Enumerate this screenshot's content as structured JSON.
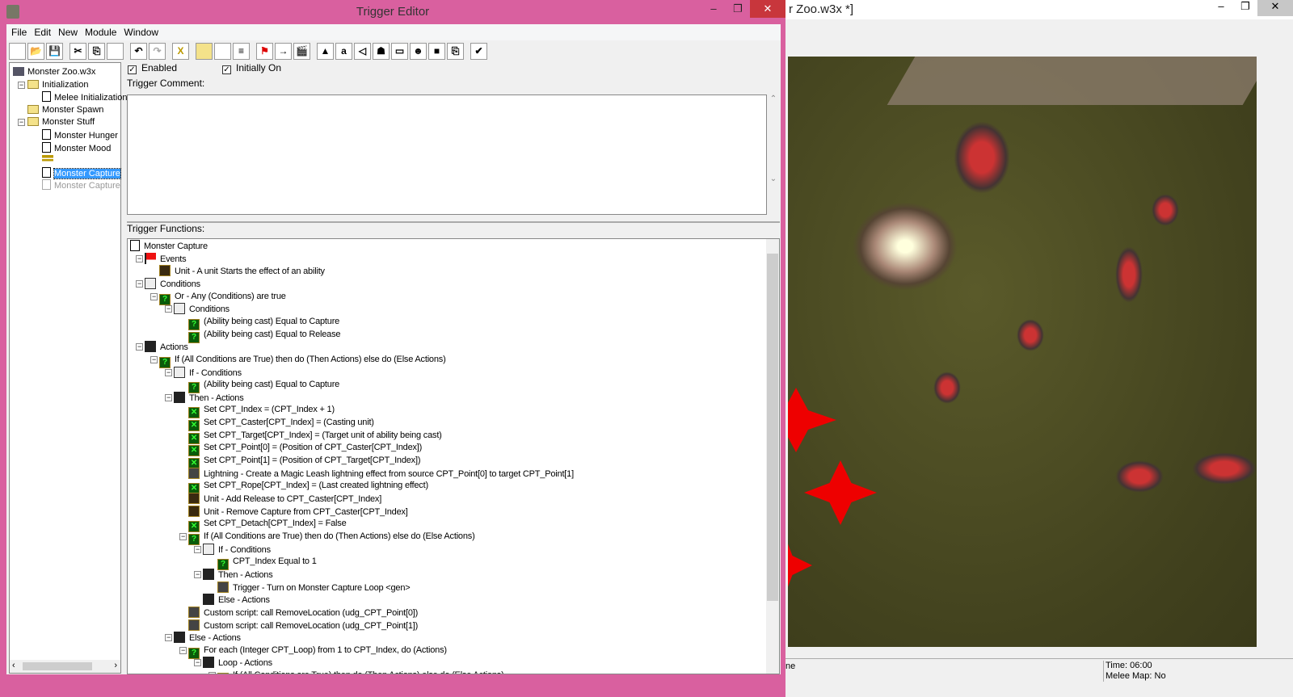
{
  "background_window": {
    "title": "r Zoo.w3x *]",
    "status_left": "ne",
    "time": "Time: 06:00",
    "melee": "Melee Map: No"
  },
  "window": {
    "title": "Trigger Editor",
    "controls": [
      "–",
      "❐",
      "✕"
    ]
  },
  "menu": [
    "File",
    "Edit",
    "New",
    "Module",
    "Window"
  ],
  "toolbar": [
    "new",
    "open",
    "save",
    "cut",
    "copy",
    "paste",
    "undo",
    "redo",
    "delete",
    "new-category",
    "new-trigger",
    "new-comment",
    "new-event",
    "new-condition",
    "new-action",
    "terrain",
    "unit",
    "sound",
    "object",
    "campaign",
    "ai",
    "import",
    "object-manager",
    "test-map"
  ],
  "tree": {
    "items": [
      {
        "label": "Monster Zoo.w3x",
        "icon": "map",
        "level": 0
      },
      {
        "label": "Initialization",
        "icon": "folder",
        "level": 1,
        "toggle": "−"
      },
      {
        "label": "Melee Initialization",
        "icon": "doc",
        "level": 2
      },
      {
        "label": "Monster Spawn",
        "icon": "folder",
        "level": 1
      },
      {
        "label": "Monster Stuff",
        "icon": "folder",
        "level": 1,
        "toggle": "−"
      },
      {
        "label": "Monster Hunger",
        "icon": "doc",
        "level": 2
      },
      {
        "label": "Monster Mood",
        "icon": "doc",
        "level": 2
      },
      {
        "label": "",
        "icon": "comment",
        "level": 2
      },
      {
        "label": "Monster Capture",
        "icon": "doc",
        "level": 2,
        "selected": true
      },
      {
        "label": "Monster Capture",
        "icon": "doc-disabled",
        "level": 2,
        "disabled": true
      }
    ]
  },
  "trigger": {
    "enabled_label": "Enabled",
    "enabled": true,
    "initially_on_label": "Initially On",
    "initially_on": true,
    "comment_label": "Trigger Comment:",
    "comment": "",
    "functions_label": "Trigger Functions:"
  },
  "functions": [
    {
      "t": "Monster Capture",
      "i": "doc",
      "l": 0
    },
    {
      "t": "Events",
      "i": "flag",
      "l": 1,
      "g": 1
    },
    {
      "t": "Unit - A unit Starts the effect of an ability",
      "i": "unit",
      "l": 2
    },
    {
      "t": "Conditions",
      "i": "cond",
      "l": 1,
      "g": 1
    },
    {
      "t": "Or - Any (Conditions) are true",
      "i": "green",
      "l": 2,
      "g": 1
    },
    {
      "t": "Conditions",
      "i": "cond",
      "l": 3,
      "g": 1
    },
    {
      "t": "(Ability being cast) Equal to Capture",
      "i": "green",
      "l": 4
    },
    {
      "t": "(Ability being cast) Equal to Release",
      "i": "green",
      "l": 4
    },
    {
      "t": "Actions",
      "i": "clap",
      "l": 1,
      "g": 1
    },
    {
      "t": "If (All Conditions are True) then do (Then Actions) else do (Else Actions)",
      "i": "green",
      "l": 2,
      "g": 1
    },
    {
      "t": "If - Conditions",
      "i": "cond",
      "l": 3,
      "g": 1
    },
    {
      "t": "(Ability being cast) Equal to Capture",
      "i": "green",
      "l": 4
    },
    {
      "t": "Then - Actions",
      "i": "clap",
      "l": 3,
      "g": 1
    },
    {
      "t": "Set CPT_Index = (CPT_Index + 1)",
      "i": "set",
      "l": 4
    },
    {
      "t": "Set CPT_Caster[CPT_Index] = (Casting unit)",
      "i": "set",
      "l": 4
    },
    {
      "t": "Set CPT_Target[CPT_Index] = (Target unit of ability being cast)",
      "i": "set",
      "l": 4
    },
    {
      "t": "Set CPT_Point[0] = (Position of CPT_Caster[CPT_Index])",
      "i": "set",
      "l": 4
    },
    {
      "t": "Set CPT_Point[1] = (Position of CPT_Target[CPT_Index])",
      "i": "set",
      "l": 4
    },
    {
      "t": "Lightning - Create a Magic Leash lightning effect from source CPT_Point[0] to target CPT_Point[1]",
      "i": "gear",
      "l": 4
    },
    {
      "t": "Set CPT_Rope[CPT_Index] = (Last created lightning effect)",
      "i": "set",
      "l": 4
    },
    {
      "t": "Unit - Add Release  to CPT_Caster[CPT_Index]",
      "i": "unit",
      "l": 4
    },
    {
      "t": "Unit - Remove Capture  from CPT_Caster[CPT_Index]",
      "i": "unit",
      "l": 4
    },
    {
      "t": "Set CPT_Detach[CPT_Index] = False",
      "i": "set",
      "l": 4
    },
    {
      "t": "If (All Conditions are True) then do (Then Actions) else do (Else Actions)",
      "i": "green",
      "l": 4,
      "g": 1
    },
    {
      "t": "If - Conditions",
      "i": "cond",
      "l": 5,
      "g": 1
    },
    {
      "t": "CPT_Index Equal to 1",
      "i": "green",
      "l": 6
    },
    {
      "t": "Then - Actions",
      "i": "clap",
      "l": 5,
      "g": 1
    },
    {
      "t": "Trigger - Turn on Monster Capture Loop <gen>",
      "i": "gear",
      "l": 6
    },
    {
      "t": "Else - Actions",
      "i": "clap",
      "l": 5
    },
    {
      "t": "Custom script:   call RemoveLocation (udg_CPT_Point[0])",
      "i": "gear",
      "l": 4
    },
    {
      "t": "Custom script:   call RemoveLocation (udg_CPT_Point[1])",
      "i": "gear",
      "l": 4
    },
    {
      "t": "Else - Actions",
      "i": "clap",
      "l": 3,
      "g": 1
    },
    {
      "t": "For each (Integer CPT_Loop) from 1 to CPT_Index, do (Actions)",
      "i": "green",
      "l": 4,
      "g": 1
    },
    {
      "t": "Loop - Actions",
      "i": "clap",
      "l": 5,
      "g": 1
    },
    {
      "t": "If (All Conditions are True) then do (Then Actions) else do (Else Actions)",
      "i": "green",
      "l": 6,
      "g": 1
    }
  ]
}
